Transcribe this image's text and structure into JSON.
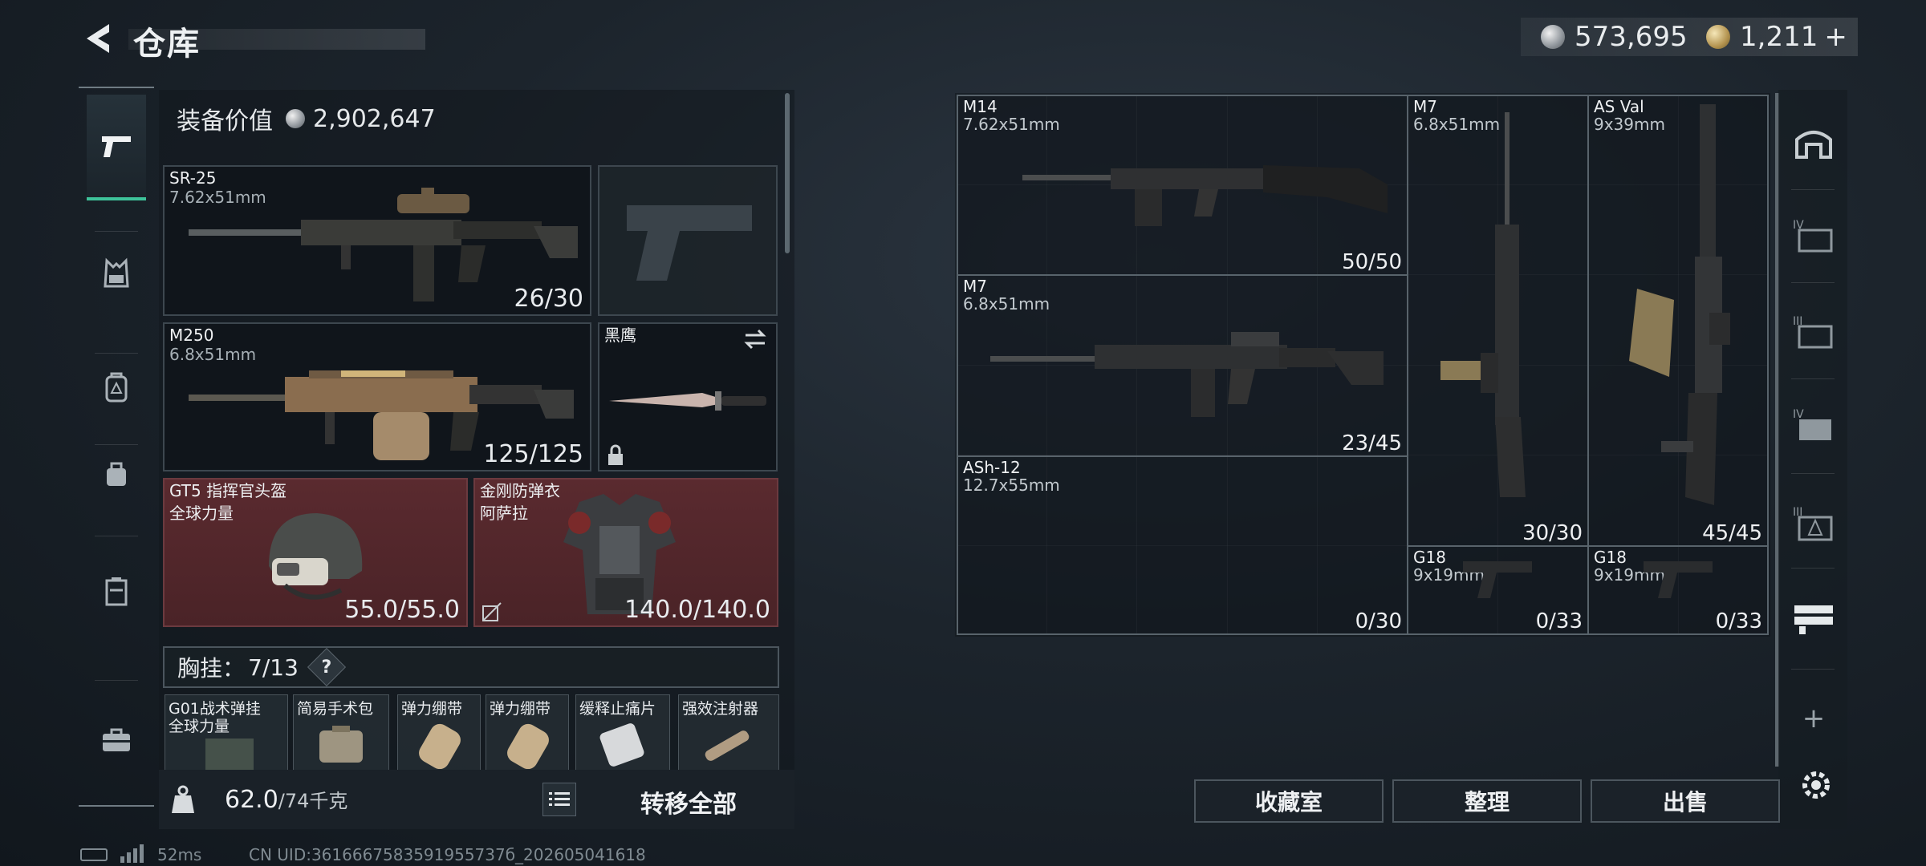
{
  "header": {
    "title": "仓库",
    "currency_silver": "573,695",
    "currency_gold": "1,211",
    "gold_plus": "+"
  },
  "loadout": {
    "value_label": "装备价值",
    "value": "2,902,647",
    "primary": {
      "name": "SR-25",
      "caliber": "7.62x51mm",
      "ammo": "26/30"
    },
    "secondary": {
      "name": "M250",
      "caliber": "6.8x51mm",
      "ammo": "125/125"
    },
    "melee": {
      "name": "黑鹰"
    },
    "helmet": {
      "name": "GT5 指挥官头盔",
      "sub": "全球力量",
      "durability": "55.0/55.0"
    },
    "armor": {
      "name": "金刚防弹衣",
      "sub": "阿萨拉",
      "durability": "140.0/140.0"
    },
    "rig": {
      "label": "胸挂：",
      "count": "7/13",
      "help": "?"
    },
    "rig_items": [
      {
        "name": "G01战术弹挂",
        "sub": "全球力量"
      },
      {
        "name": "简易手术包"
      },
      {
        "name": "弹力绷带"
      },
      {
        "name": "弹力绷带"
      },
      {
        "name": "缓释止痛片"
      },
      {
        "name": "强效注射器"
      }
    ],
    "weight": "62.0",
    "weight_max": "/74千克",
    "transfer_all": "转移全部"
  },
  "storage": {
    "items": [
      {
        "name": "M14",
        "caliber": "7.62x51mm",
        "count": "50/50"
      },
      {
        "name": "M7",
        "caliber": "6.8x51mm",
        "count": "23/45"
      },
      {
        "name": "ASh-12",
        "caliber": "12.7x55mm",
        "count": "0/30"
      },
      {
        "name": "M7",
        "caliber": "6.8x51mm",
        "count": "30/30"
      },
      {
        "name": "AS Val",
        "caliber": "9x39mm",
        "count": "45/45"
      },
      {
        "name": "G18",
        "caliber": "9x19mm",
        "count": "0/33"
      },
      {
        "name": "G18",
        "caliber": "9x19mm",
        "count": "0/33"
      }
    ],
    "buttons": {
      "collection": "收藏室",
      "organize": "整理",
      "sell": "出售"
    },
    "add": "+"
  },
  "status": {
    "ping": "52ms",
    "uid": "CN UID:3616667583591955737б_202605041618"
  },
  "colors": {
    "accent": "#3ec39a",
    "red_slot": "#5a2a2f",
    "panel": "#1a2128"
  }
}
